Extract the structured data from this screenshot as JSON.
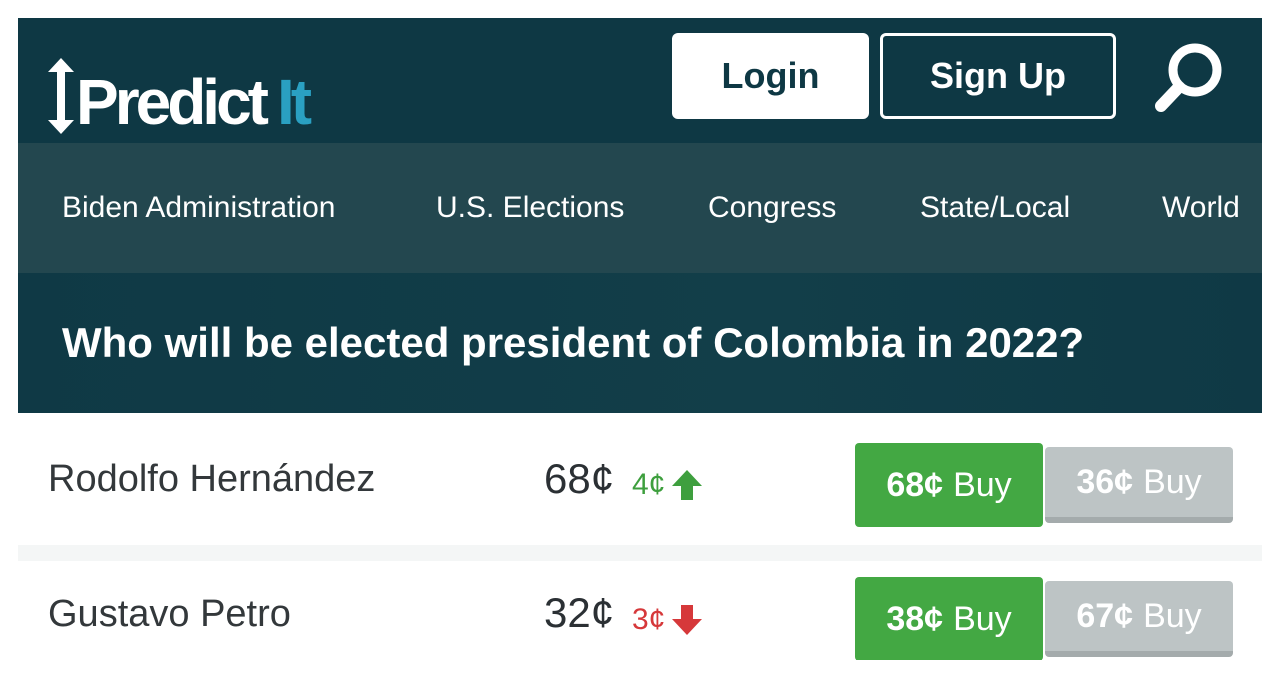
{
  "header": {
    "logo_text_main": "Predict",
    "logo_text_accent": "It",
    "login_label": "Login",
    "signup_label": "Sign Up",
    "search_icon": "search-icon"
  },
  "nav": {
    "items": [
      {
        "label": "Biden Administration"
      },
      {
        "label": "U.S. Elections"
      },
      {
        "label": "Congress"
      },
      {
        "label": "State/Local"
      },
      {
        "label": "World"
      }
    ]
  },
  "market": {
    "question": "Who will be elected president of Colombia in 2022?",
    "contracts": [
      {
        "name": "Rodolfo Hernández",
        "price": "68¢",
        "change": "4¢",
        "direction": "up",
        "buy_yes_price": "68¢",
        "buy_yes_label": "Buy",
        "buy_no_price": "36¢",
        "buy_no_label": "Buy"
      },
      {
        "name": "Gustavo Petro",
        "price": "32¢",
        "change": "3¢",
        "direction": "down",
        "buy_yes_price": "38¢",
        "buy_yes_label": "Buy",
        "buy_no_price": "67¢",
        "buy_no_label": "Buy"
      }
    ]
  },
  "colors": {
    "header_bg": "#0e3844",
    "nav_bg": "#23474f",
    "logo_accent": "#2aa0c2",
    "buy_yes": "#43a843",
    "buy_no": "#bdc4c5",
    "up": "#3e9f3e",
    "down": "#d6383a"
  }
}
